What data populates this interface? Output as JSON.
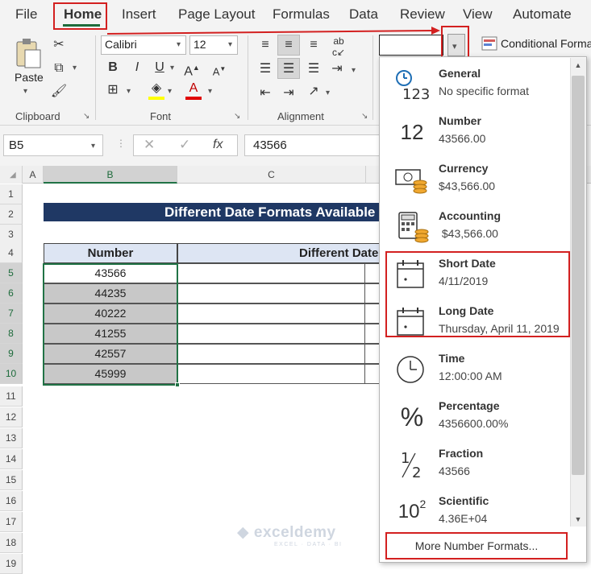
{
  "menu": {
    "items": [
      "File",
      "Home",
      "Insert",
      "Page Layout",
      "Formulas",
      "Data",
      "Review",
      "View",
      "Automate"
    ],
    "active": "Home"
  },
  "ribbon": {
    "clipboard": {
      "paste_label": "Paste",
      "group_label": "Clipboard"
    },
    "font": {
      "font_name": "Calibri",
      "font_size": "12",
      "group_label": "Font",
      "bold": "B",
      "italic": "I",
      "underline": "U"
    },
    "alignment": {
      "group_label": "Alignment"
    },
    "number": {
      "format_value": ""
    },
    "styles": {
      "conditional_label": "Conditional Formatting"
    }
  },
  "formula_bar": {
    "name_box": "B5",
    "fx": "fx",
    "formula": "43566"
  },
  "grid": {
    "columns": [
      "A",
      "B",
      "C"
    ],
    "rows": [
      "1",
      "2",
      "3",
      "4",
      "5",
      "6",
      "7",
      "8",
      "9",
      "10",
      "11",
      "12",
      "13",
      "14",
      "15",
      "16",
      "17",
      "18",
      "19"
    ],
    "title": "Different Date Formats Available",
    "header_number": "Number",
    "header_formats": "Different Date Formats",
    "numbers": [
      "43566",
      "44235",
      "40222",
      "41255",
      "42557",
      "45999"
    ]
  },
  "number_format_dropdown": {
    "items": [
      {
        "name": "General",
        "sample": "No specific format",
        "icon": "clock-123-icon"
      },
      {
        "name": "Number",
        "sample": "43566.00",
        "icon": "number-12-icon"
      },
      {
        "name": "Currency",
        "sample": "$43,566.00",
        "icon": "currency-icon"
      },
      {
        "name": "Accounting",
        "sample": " $43,566.00",
        "icon": "accounting-icon"
      },
      {
        "name": "Short Date",
        "sample": "4/11/2019",
        "icon": "calendar-icon"
      },
      {
        "name": "Long Date",
        "sample": "Thursday, April 11, 2019",
        "icon": "calendar-icon"
      },
      {
        "name": "Time",
        "sample": "12:00:00 AM",
        "icon": "clock-icon"
      },
      {
        "name": "Percentage",
        "sample": "4356600.00%",
        "icon": "percent-icon"
      },
      {
        "name": "Fraction",
        "sample": "43566",
        "icon": "fraction-icon"
      },
      {
        "name": "Scientific",
        "sample": "4.36E+04",
        "icon": "scientific-icon"
      }
    ],
    "more_label": "More Number Formats...",
    "glyphs": {
      "number": "12",
      "percent": "%",
      "fraction_top": "1",
      "fraction_bottom": "2",
      "sci_base": "10",
      "sci_exp": "2",
      "general_top": "",
      "general_bottom": "123"
    }
  },
  "watermark": {
    "brand": "exceldemy",
    "tagline": "EXCEL · DATA · BI"
  },
  "colors": {
    "title_bg": "#1f3864",
    "header_bg": "#dde5f3",
    "shaded": "#c8c8c8",
    "accent": "#217346",
    "highlight": "#d32020"
  }
}
